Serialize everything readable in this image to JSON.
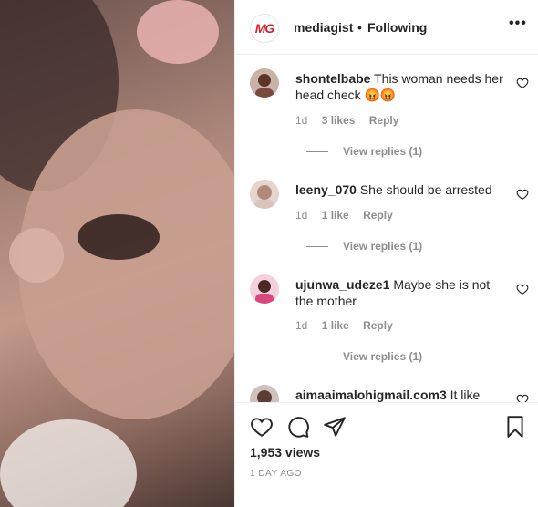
{
  "header": {
    "avatar_text": "MG",
    "username": "mediagist",
    "separator": "•",
    "follow_label": "Following",
    "more_label": "•••"
  },
  "comments": [
    {
      "username": "shontelbabe",
      "text": "This woman needs her head check 😡😡",
      "age": "1d",
      "likes": "3 likes",
      "reply_label": "Reply",
      "view_replies": "View replies (1)",
      "avatar_color": "#7a4a3d"
    },
    {
      "username": "leeny_070",
      "text": "She should be arrested",
      "age": "1d",
      "likes": "1 like",
      "reply_label": "Reply",
      "view_replies": "View replies (1)",
      "avatar_color": "#b28a7c"
    },
    {
      "username": "ujunwa_udeze1",
      "text": "Maybe she is not the mother",
      "age": "1d",
      "likes": "1 like",
      "reply_label": "Reply",
      "view_replies": "View replies (1)",
      "avatar_color": "#d9487a"
    },
    {
      "username": "aimaaimalohigmail.com3",
      "text": "It like",
      "avatar_color": "#5a3e36"
    }
  ],
  "actions": {
    "like_icon": "heart-outline",
    "comment_icon": "speech-bubble",
    "share_icon": "paper-plane",
    "save_icon": "bookmark",
    "views": "1,953 views",
    "date": "1 DAY AGO"
  }
}
